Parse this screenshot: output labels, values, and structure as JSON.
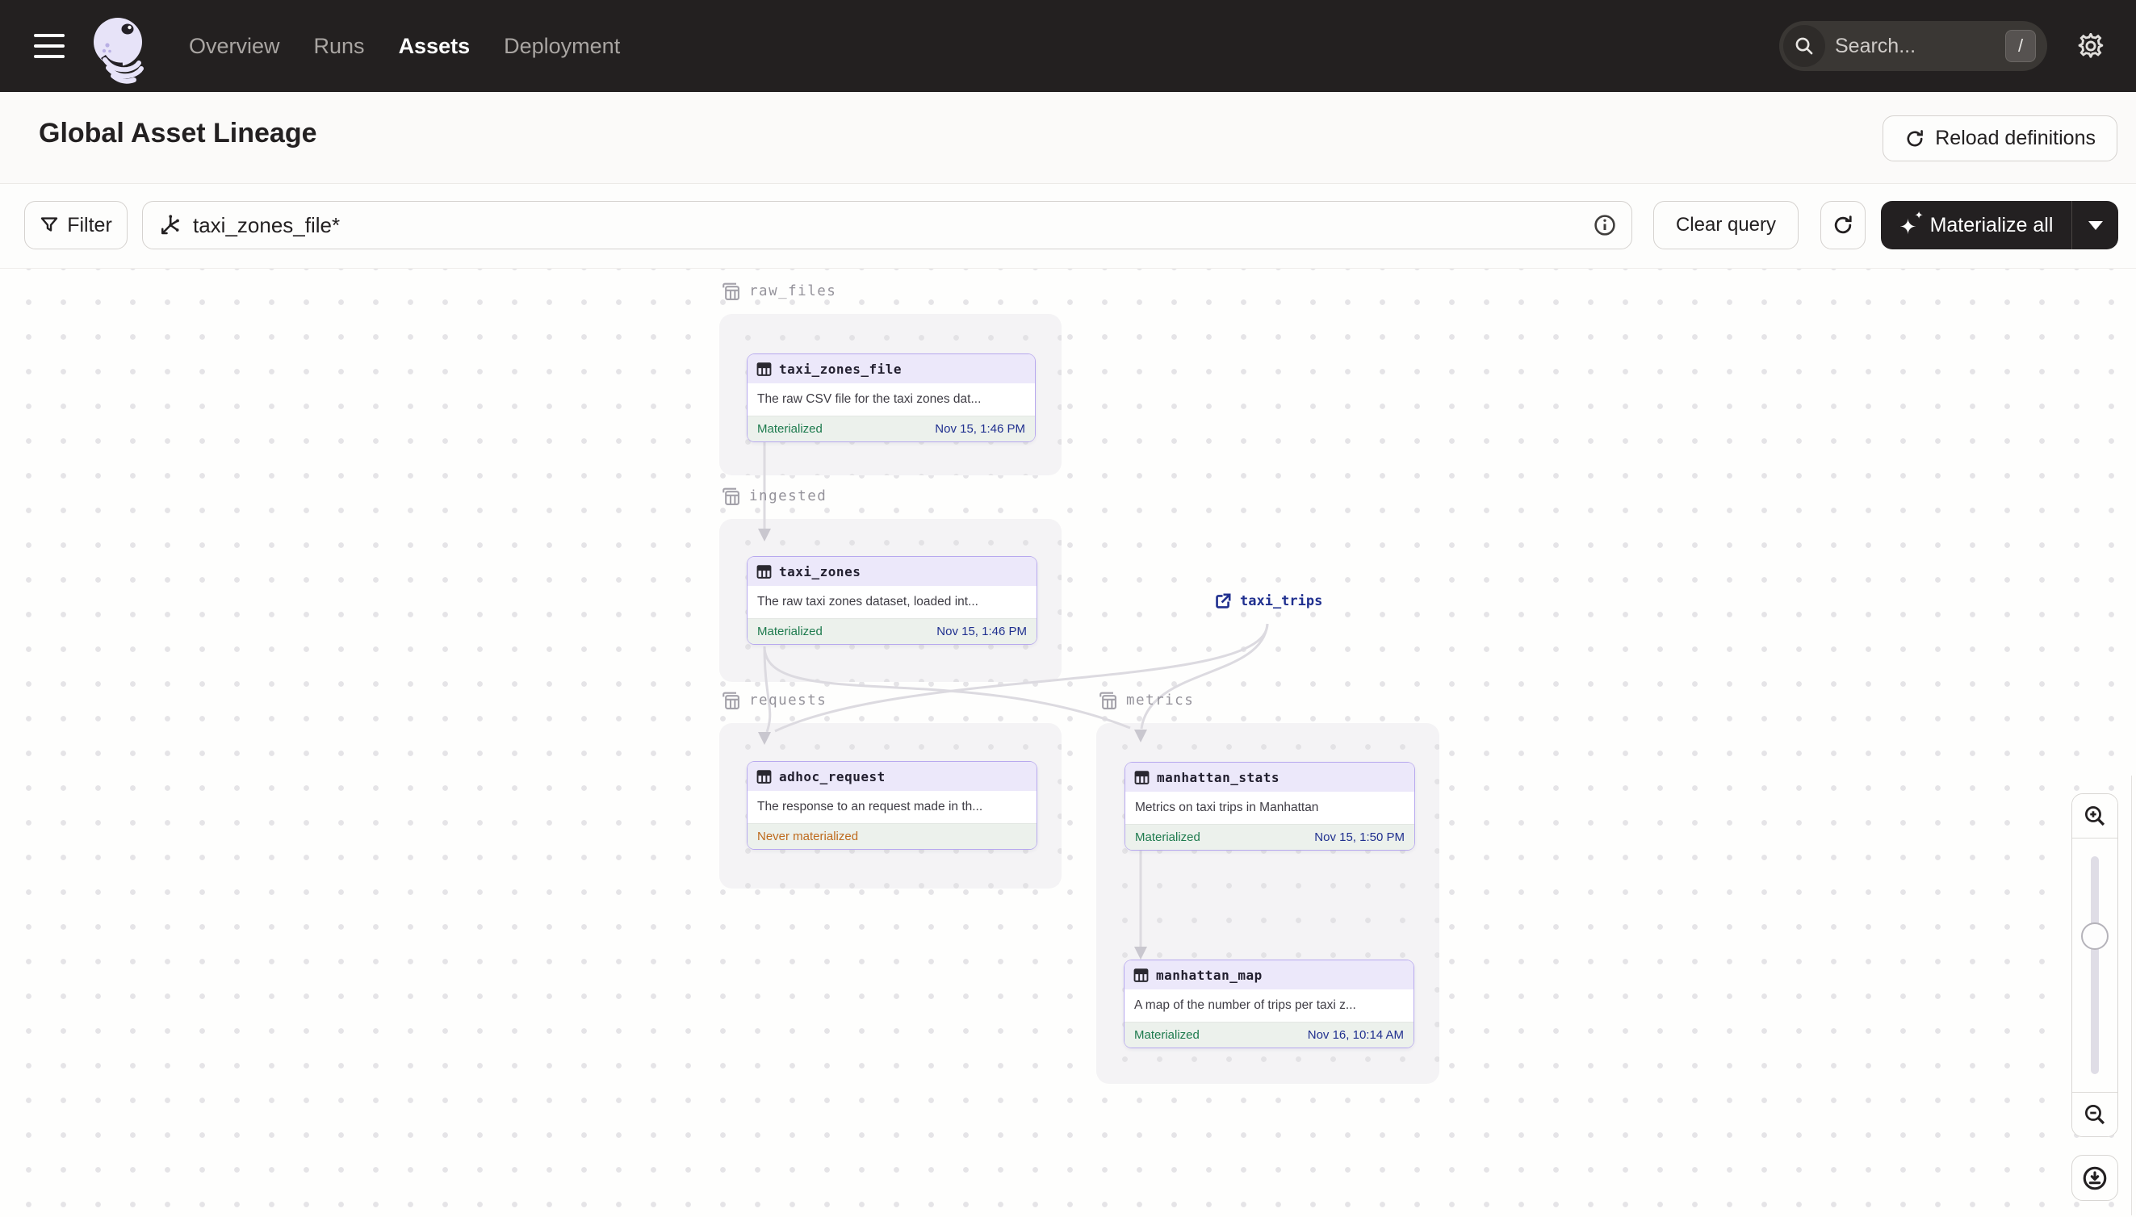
{
  "navbar": {
    "links": [
      {
        "label": "Overview"
      },
      {
        "label": "Runs"
      },
      {
        "label": "Assets"
      },
      {
        "label": "Deployment"
      }
    ],
    "active_link": "Assets",
    "search": {
      "placeholder": "Search...",
      "shortcut": "/"
    }
  },
  "header": {
    "title": "Global Asset Lineage",
    "reload_button": "Reload definitions"
  },
  "toolbar": {
    "filter_button": "Filter",
    "query_value": "taxi_zones_file*",
    "clear_button": "Clear query",
    "materialize_button": "Materialize all"
  },
  "graph": {
    "groups": [
      {
        "name": "raw_files"
      },
      {
        "name": "ingested"
      },
      {
        "name": "requests"
      },
      {
        "name": "metrics"
      }
    ],
    "nodes": [
      {
        "name": "taxi_zones_file",
        "description": "The raw CSV file for the taxi zones dat...",
        "status": "Materialized",
        "timestamp": "Nov 15, 1:46 PM",
        "group": "raw_files"
      },
      {
        "name": "taxi_zones",
        "description": "The raw taxi zones dataset, loaded int...",
        "status": "Materialized",
        "timestamp": "Nov 15, 1:46 PM",
        "group": "ingested"
      },
      {
        "name": "adhoc_request",
        "description": "The response to an request made in th...",
        "status": "Never materialized",
        "timestamp": "",
        "group": "requests"
      },
      {
        "name": "manhattan_stats",
        "description": "Metrics on taxi trips in Manhattan",
        "status": "Materialized",
        "timestamp": "Nov 15, 1:50 PM",
        "group": "metrics"
      },
      {
        "name": "manhattan_map",
        "description": "A map of the number of trips per taxi z...",
        "status": "Materialized",
        "timestamp": "Nov 16, 10:14 AM",
        "group": "metrics"
      }
    ],
    "external_assets": [
      {
        "name": "taxi_trips"
      }
    ]
  },
  "colors": {
    "navbar_dark": "#232020",
    "accent_purple_border": "#B7A8EE",
    "node_header_lavender": "#ECE8FA",
    "materialized_green": "#1E7B4E",
    "never_materialized_orange": "#BE6A1D",
    "timestamp_navy": "#20308F",
    "edge_gray": "#DCDAE0",
    "group_bg": "#F4F3F5"
  }
}
